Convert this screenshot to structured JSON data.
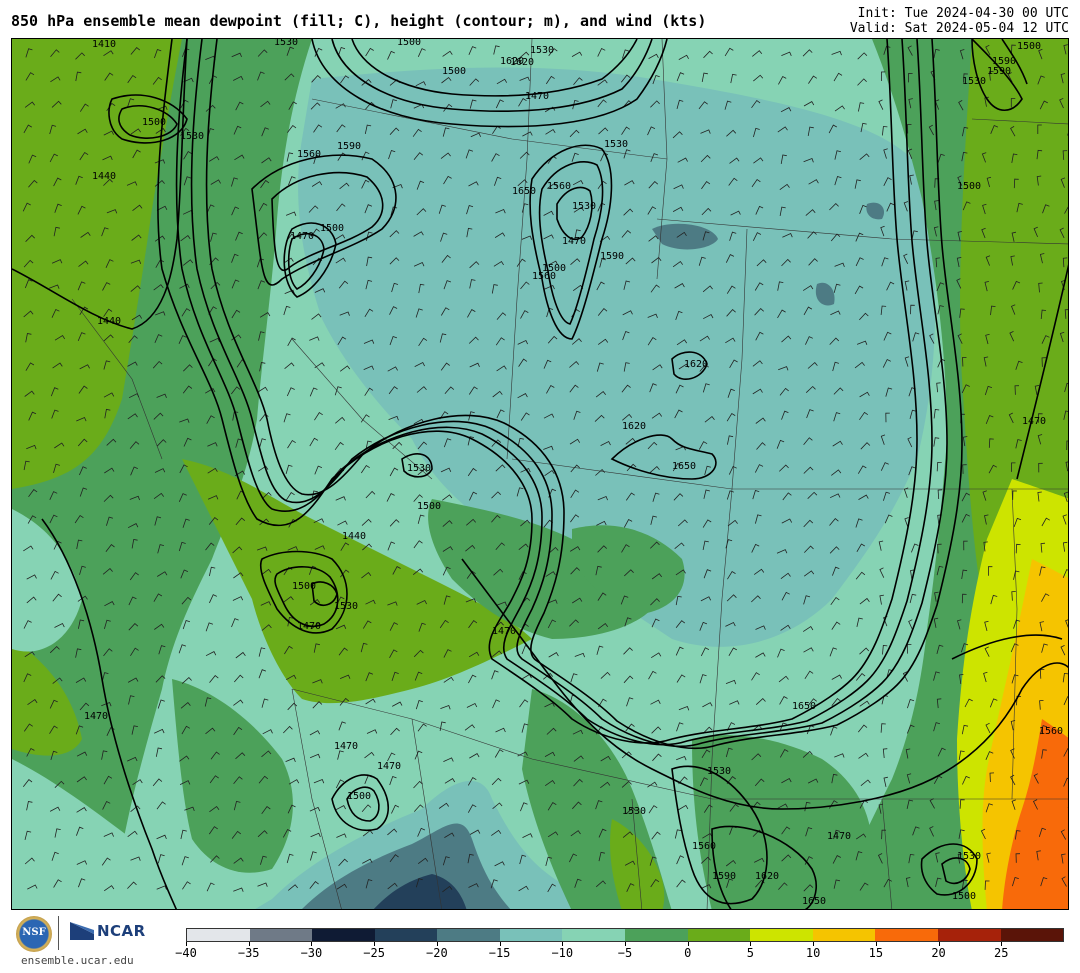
{
  "header": {
    "title": "850 hPa ensemble mean dewpoint (fill; C), height (contour; m), and wind (kts)",
    "init": "Init: Tue 2024-04-30 00 UTC",
    "valid": "Valid: Sat 2024-05-04 12 UTC"
  },
  "footer": {
    "nsf_logo_text": "NSF",
    "ncar_logo_text": "NCAR",
    "site_url": "ensemble.ucar.edu"
  },
  "colorbar": {
    "tick_labels": [
      "-40",
      "-35",
      "-30",
      "-25",
      "-20",
      "-15",
      "-10",
      "-5",
      "0",
      "5",
      "10",
      "15",
      "20",
      "25"
    ],
    "colors": [
      "#e3e6ea",
      "#6f7a87",
      "#0f1b34",
      "#23405a",
      "#4d7b84",
      "#79c1b9",
      "#86d3b4",
      "#4ca15a",
      "#6aac1a",
      "#cde400",
      "#f5c400",
      "#f86a0a",
      "#a6220a",
      "#5a1408"
    ]
  },
  "map": {
    "fill_colors": {
      "very_dry": "#4d7b84",
      "dry_dark": "#23405a",
      "dry": "#79c1b9",
      "mid": "#86d3b4",
      "moist": "#4ca15a",
      "moister": "#6aac1a",
      "humid": "#cde400",
      "warm": "#f5c400",
      "hot": "#f86a0a"
    },
    "contour_labels": [
      "1410",
      "1500",
      "1530",
      "1530",
      "1440",
      "1440",
      "1470",
      "1500",
      "1500",
      "1560",
      "1620",
      "1530",
      "1470",
      "1500",
      "1560",
      "1590",
      "1470",
      "1620",
      "1530",
      "1500",
      "1560",
      "1650",
      "1590",
      "1530",
      "1620",
      "1620",
      "1650",
      "1530",
      "1500",
      "1440",
      "1500",
      "1530",
      "1470",
      "1470",
      "1470",
      "1470",
      "1500",
      "1470",
      "1650",
      "1530",
      "1530",
      "1590",
      "1560",
      "1620",
      "1650",
      "1560",
      "1470",
      "1500",
      "1530",
      "1470",
      "1500",
      "1590",
      "1500",
      "1530",
      "1590"
    ]
  }
}
